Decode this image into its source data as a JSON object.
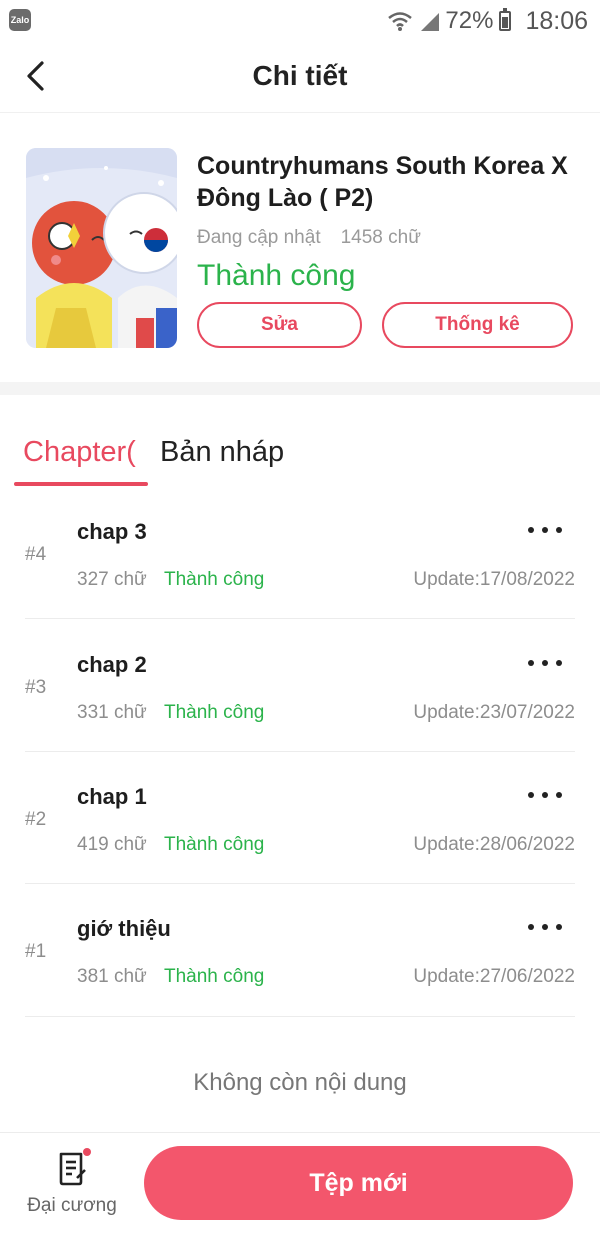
{
  "status_bar": {
    "app_badge": "Zalo",
    "battery_percent": "72%",
    "time": "18:06"
  },
  "header": {
    "title": "Chi tiết"
  },
  "book": {
    "title": "Countryhumans South Korea X Đông Lào ( P2)",
    "update_status": "Đang cập nhật",
    "word_count": "1458 chữ",
    "publish_status": "Thành công",
    "edit_label": "Sửa",
    "stats_label": "Thống kê"
  },
  "tabs": [
    {
      "label": "Chapter(",
      "active": true
    },
    {
      "label": "Bản nháp",
      "active": false
    }
  ],
  "chapters": [
    {
      "number": "#4",
      "title": "chap 3",
      "words": "327 chữ",
      "status": "Thành công",
      "updated": "Update:17/08/2022"
    },
    {
      "number": "#3",
      "title": "chap 2",
      "words": "331 chữ",
      "status": "Thành công",
      "updated": "Update:23/07/2022"
    },
    {
      "number": "#2",
      "title": "chap 1",
      "words": "419 chữ",
      "status": "Thành công",
      "updated": "Update:28/06/2022"
    },
    {
      "number": "#1",
      "title": "giớ thiệu",
      "words": "381 chữ",
      "status": "Thành công",
      "updated": "Update:27/06/2022"
    }
  ],
  "list_end_text": "Không còn nội dung",
  "bottom_bar": {
    "outline_label": "Đại cương",
    "new_file_label": "Tệp mới"
  },
  "colors": {
    "accent": "#e8495f",
    "success": "#2bb34b",
    "primary_button": "#f3566c"
  },
  "icons": [
    "back-icon",
    "wifi-icon",
    "signal-icon",
    "battery-icon",
    "more-icon",
    "outline-document-icon"
  ]
}
